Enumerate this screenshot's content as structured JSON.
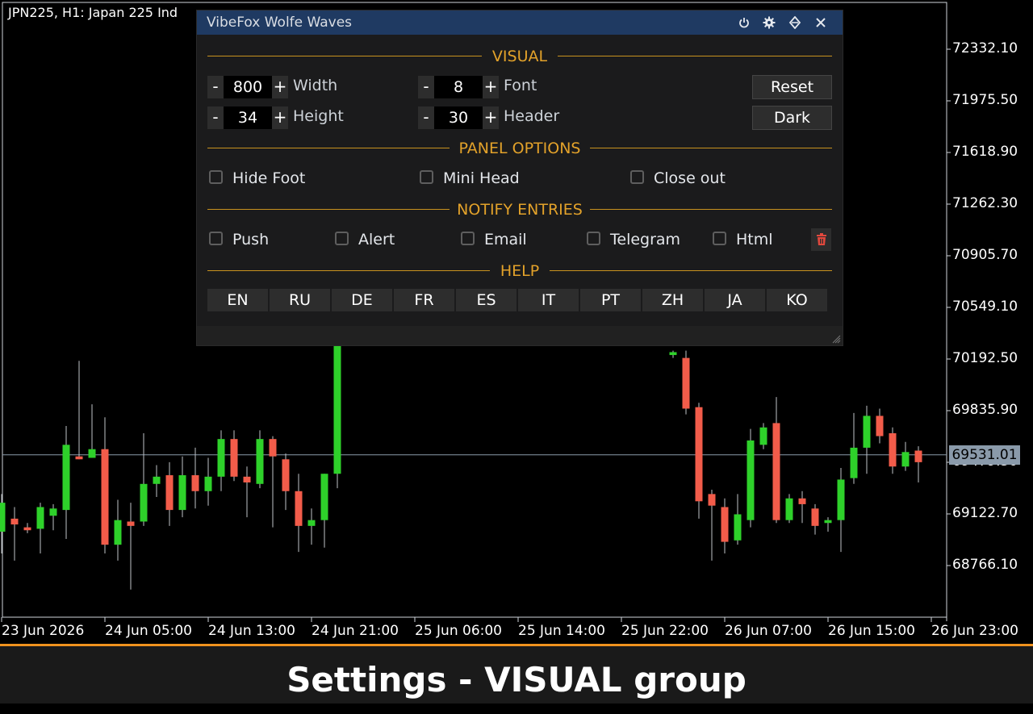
{
  "chart": {
    "symbol_title": "JPN225, H1:  Japan 225 Ind",
    "current_price": "69531.01",
    "colors": {
      "bull": "#2ed12a",
      "bear": "#f25c4a",
      "grid": "#cfd4da",
      "price_line": "#8a9aaa"
    }
  },
  "chart_data": {
    "type": "candlestick",
    "title": "JPN225, H1:  Japan 225 Ind",
    "y_ticks": [
      "72332.10",
      "71975.50",
      "71618.90",
      "71262.30",
      "70905.70",
      "70549.10",
      "70192.50",
      "69835.90",
      "69479.30",
      "69122.70",
      "68766.10"
    ],
    "x_ticks": [
      "23 Jun 2026",
      "24 Jun 05:00",
      "24 Jun 13:00",
      "24 Jun 21:00",
      "25 Jun 06:00",
      "25 Jun 14:00",
      "25 Jun 22:00",
      "26 Jun 07:00",
      "26 Jun 15:00",
      "26 Jun 23:00"
    ],
    "ylim": [
      68600,
      72400
    ],
    "current_price": 69531.01,
    "candles": [
      {
        "o": 69000,
        "c": 69200,
        "h": 69260,
        "l": 68850
      },
      {
        "o": 69090,
        "c": 69050,
        "h": 69170,
        "l": 68800
      },
      {
        "o": 69030,
        "c": 69010,
        "h": 69060,
        "l": 68990
      },
      {
        "o": 69020,
        "c": 69170,
        "h": 69200,
        "l": 68850
      },
      {
        "o": 69110,
        "c": 69160,
        "h": 69190,
        "l": 69010
      },
      {
        "o": 69150,
        "c": 69600,
        "h": 69730,
        "l": 68950
      },
      {
        "o": 69520,
        "c": 69500,
        "h": 70180,
        "l": 69500
      },
      {
        "o": 69510,
        "c": 69570,
        "h": 69880,
        "l": 69510
      },
      {
        "o": 69570,
        "c": 68910,
        "h": 69790,
        "l": 68850
      },
      {
        "o": 68910,
        "c": 69080,
        "h": 69220,
        "l": 68800
      },
      {
        "o": 69070,
        "c": 69040,
        "h": 69200,
        "l": 68600
      },
      {
        "o": 69070,
        "c": 69330,
        "h": 69680,
        "l": 69040
      },
      {
        "o": 69330,
        "c": 69380,
        "h": 69460,
        "l": 69240
      },
      {
        "o": 69390,
        "c": 69150,
        "h": 69480,
        "l": 69040
      },
      {
        "o": 69150,
        "c": 69390,
        "h": 69520,
        "l": 69100
      },
      {
        "o": 69390,
        "c": 69280,
        "h": 69580,
        "l": 69160
      },
      {
        "o": 69280,
        "c": 69380,
        "h": 69510,
        "l": 69180
      },
      {
        "o": 69380,
        "c": 69640,
        "h": 69700,
        "l": 69280
      },
      {
        "o": 69640,
        "c": 69380,
        "h": 69700,
        "l": 69350
      },
      {
        "o": 69380,
        "c": 69340,
        "h": 69450,
        "l": 69100
      },
      {
        "o": 69330,
        "c": 69640,
        "h": 69700,
        "l": 69300
      },
      {
        "o": 69640,
        "c": 69520,
        "h": 69660,
        "l": 69030
      },
      {
        "o": 69500,
        "c": 69280,
        "h": 69540,
        "l": 69150
      },
      {
        "o": 69280,
        "c": 69040,
        "h": 69400,
        "l": 68860
      },
      {
        "o": 69040,
        "c": 69080,
        "h": 69160,
        "l": 68910
      },
      {
        "o": 69080,
        "c": 69400,
        "h": 69400,
        "l": 68890
      },
      {
        "o": 69400,
        "c": 70400,
        "h": 70400,
        "l": 69300
      },
      {
        "o": 70220,
        "c": 70240,
        "h": 70250,
        "l": 70200
      },
      {
        "o": 70200,
        "c": 69850,
        "h": 70250,
        "l": 69810
      },
      {
        "o": 69860,
        "c": 69210,
        "h": 69890,
        "l": 69090
      },
      {
        "o": 69260,
        "c": 69180,
        "h": 69290,
        "l": 68800
      },
      {
        "o": 69170,
        "c": 68930,
        "h": 69230,
        "l": 68850
      },
      {
        "o": 68940,
        "c": 69120,
        "h": 69260,
        "l": 68910
      },
      {
        "o": 69080,
        "c": 69630,
        "h": 69710,
        "l": 69030
      },
      {
        "o": 69600,
        "c": 69720,
        "h": 69750,
        "l": 69570
      },
      {
        "o": 69750,
        "c": 69080,
        "h": 69930,
        "l": 69060
      },
      {
        "o": 69080,
        "c": 69230,
        "h": 69260,
        "l": 69060
      },
      {
        "o": 69230,
        "c": 69190,
        "h": 69280,
        "l": 69060
      },
      {
        "o": 69160,
        "c": 69040,
        "h": 69190,
        "l": 68980
      },
      {
        "o": 69060,
        "c": 69080,
        "h": 69100,
        "l": 69000
      },
      {
        "o": 69080,
        "c": 69360,
        "h": 69440,
        "l": 68860
      },
      {
        "o": 69370,
        "c": 69580,
        "h": 69820,
        "l": 69330
      },
      {
        "o": 69580,
        "c": 69800,
        "h": 69870,
        "l": 69400
      },
      {
        "o": 69800,
        "c": 69660,
        "h": 69850,
        "l": 69610
      },
      {
        "o": 69680,
        "c": 69450,
        "h": 69720,
        "l": 69400
      },
      {
        "o": 69450,
        "c": 69550,
        "h": 69620,
        "l": 69420
      },
      {
        "o": 69560,
        "c": 69480,
        "h": 69590,
        "l": 69340
      }
    ]
  },
  "panel": {
    "title": "VibeFox Wolfe Waves",
    "icons": {
      "power": "power-icon",
      "settings": "gear-icon",
      "expand": "expand-icon",
      "close": "close-icon"
    },
    "visual": {
      "section_title": "VISUAL",
      "width_value": "800",
      "width_label": "Width",
      "height_value": "34",
      "height_label": "Height",
      "font_value": "8",
      "font_label": "Font",
      "header_value": "30",
      "header_label": "Header",
      "minus": "-",
      "plus": "+",
      "reset_label": "Reset",
      "dark_label": "Dark"
    },
    "panel_options": {
      "section_title": "PANEL OPTIONS",
      "hide_foot": "Hide Foot",
      "mini_head": "Mini Head",
      "close_out": "Close out"
    },
    "notify_entries": {
      "section_title": "NOTIFY ENTRIES",
      "push": "Push",
      "alert": "Alert",
      "email": "Email",
      "telegram": "Telegram",
      "html": "Html",
      "delete_icon": "trash-icon"
    },
    "help": {
      "section_title": "HELP",
      "languages": [
        "EN",
        "RU",
        "DE",
        "FR",
        "ES",
        "IT",
        "PT",
        "ZH",
        "JA",
        "KO"
      ]
    }
  },
  "caption": "Settings - VISUAL group"
}
